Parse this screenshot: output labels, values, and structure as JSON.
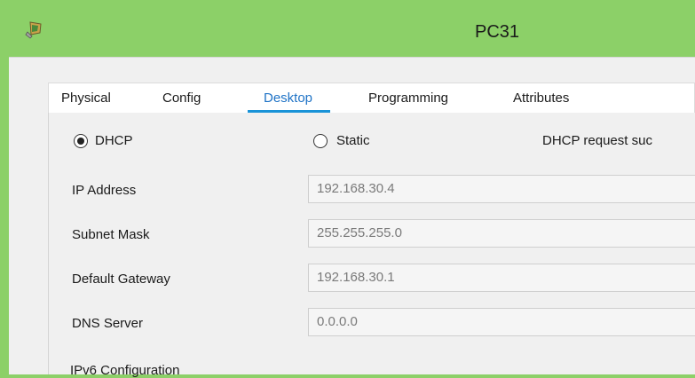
{
  "window": {
    "title": "PC31",
    "icon": "pc-icon"
  },
  "tabs": [
    {
      "label": "Physical",
      "active": false
    },
    {
      "label": "Config",
      "active": false
    },
    {
      "label": "Desktop",
      "active": true
    },
    {
      "label": "Programming",
      "active": false
    },
    {
      "label": "Attributes",
      "active": false
    }
  ],
  "ip_config": {
    "mode_dhcp_label": "DHCP",
    "mode_static_label": "Static",
    "selected_mode": "DHCP",
    "status_text": "DHCP request suc",
    "fields": [
      {
        "label": "IP Address",
        "value": "192.168.30.4"
      },
      {
        "label": "Subnet Mask",
        "value": "255.255.255.0"
      },
      {
        "label": "Default Gateway",
        "value": "192.168.30.1"
      },
      {
        "label": "DNS Server",
        "value": "0.0.0.0"
      }
    ],
    "ipv6_section_label": "IPv6 Configuration"
  },
  "colors": {
    "titlebar": "#8cd068",
    "accent": "#1993d8",
    "active_tab_text": "#1f73c6"
  }
}
